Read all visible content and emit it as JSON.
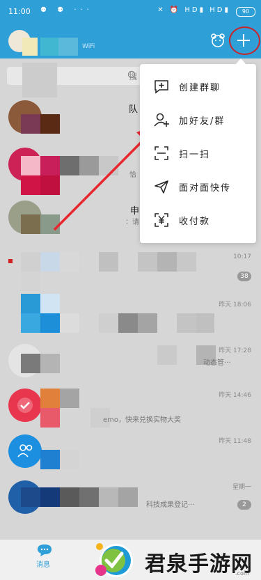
{
  "status_bar": {
    "time": "11:00",
    "left_icons": "⚉ ⚉ ···",
    "right_icons": "✕ ⏰ HD▮ HD▮",
    "battery": "90"
  },
  "header": {
    "wifi_label": "WiFi"
  },
  "search": {
    "placeholder": "搜"
  },
  "dropdown": {
    "items": [
      {
        "label": "创建群聊",
        "icon": "chat-plus-icon"
      },
      {
        "label": "加好友/群",
        "icon": "add-friend-icon"
      },
      {
        "label": "扫一扫",
        "icon": "scan-icon"
      },
      {
        "label": "面对面快传",
        "icon": "send-icon"
      },
      {
        "label": "收付款",
        "icon": "yuan-icon"
      }
    ]
  },
  "chats": [
    {
      "name": "队",
      "preview": "",
      "time": "",
      "badge": ""
    },
    {
      "name": "",
      "preview": "恰",
      "time": "",
      "badge": ""
    },
    {
      "name": "申",
      "preview": "：请",
      "time": "",
      "badge": ""
    },
    {
      "name": "",
      "preview": "",
      "time": "10:17",
      "badge": "38"
    },
    {
      "name": "",
      "preview": "",
      "time": "昨天 18:06",
      "badge": ""
    },
    {
      "name": "",
      "preview": "动态管···",
      "time": "昨天 17:28",
      "badge": ""
    },
    {
      "name": "",
      "preview": "emo，快来兑换实物大奖",
      "time": "昨天 14:46",
      "badge": ""
    },
    {
      "name": "",
      "preview": "",
      "time": "昨天 11:48",
      "badge": ""
    },
    {
      "name": "",
      "preview": "科技成果登记···",
      "time": "星期一",
      "badge": "2"
    }
  ],
  "bottom_nav": {
    "messages_label": "消息"
  },
  "watermark": {
    "text": "君泉手游网",
    "domain": ".com"
  },
  "colors": {
    "header": "#2f9fd8",
    "highlight_ring": "#c8262d",
    "arrow": "#e8262d"
  }
}
